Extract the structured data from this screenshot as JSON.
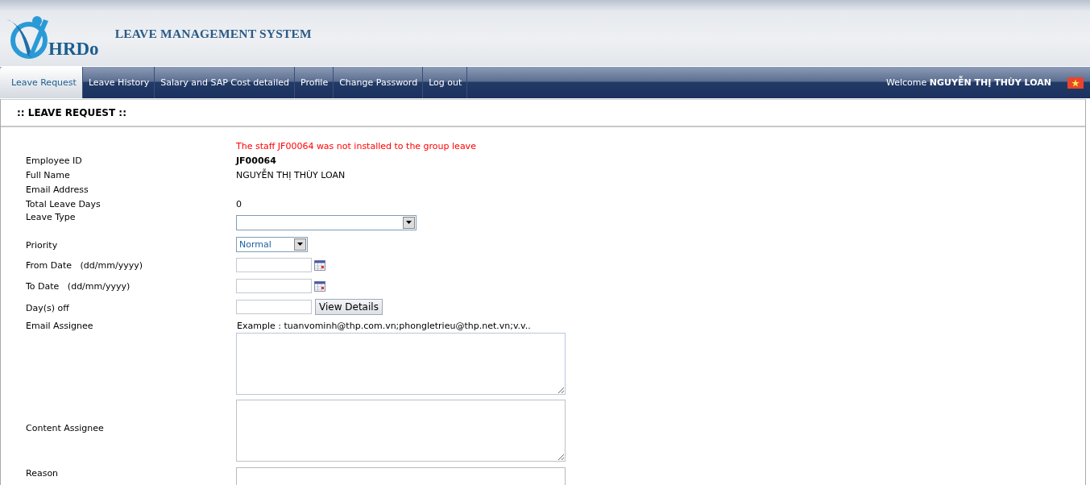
{
  "header": {
    "logo_text": "HRDo",
    "title": "LEAVE MANAGEMENT SYSTEM"
  },
  "nav": {
    "tabs": [
      {
        "label": "Leave Request",
        "selected": true
      },
      {
        "label": "Leave History",
        "selected": false
      },
      {
        "label": "Salary and SAP Cost detailed",
        "selected": false
      },
      {
        "label": "Profile",
        "selected": false
      },
      {
        "label": "Change Password",
        "selected": false
      },
      {
        "label": "Log out",
        "selected": false
      }
    ],
    "welcome": "Welcome **NGUYỄN THỊ THÙY LOAN**"
  },
  "page": {
    "title": ":: LEAVE REQUEST ::",
    "error": "The staff JF00064 was not installed to the group leave",
    "fields": [
      {
        "kind": "strong",
        "label": "Employee ID",
        "value": "JF00064"
      },
      {
        "kind": "text",
        "label": "Full Name",
        "value": "NGUYỄN THỊ THÙY LOAN"
      },
      {
        "kind": "text",
        "label": "Email Address"
      },
      {
        "kind": "text",
        "label": "Total Leave Days",
        "value": "0"
      },
      {
        "kind": "select",
        "label": "Leave Type"
      },
      {
        "kind": "combo",
        "label": "Priority",
        "value": "Normal"
      },
      {
        "kind": "date",
        "label": "From Date   (dd/mm/yyyy)"
      },
      {
        "kind": "date",
        "label": "To Date   (dd/mm/yyyy)"
      },
      {
        "kind": "button",
        "label": "Day(s) off",
        "button": "View Details"
      },
      {
        "kind": "email",
        "label": "Email Assignee",
        "hint": "Example : tuanvominh@thp.com.vn;phongletrieu@thp.net.vn;v.v.."
      },
      {
        "kind": "textarea",
        "label": "Content Assignee"
      },
      {
        "kind": "cut",
        "label": "Reason"
      }
    ]
  }
}
